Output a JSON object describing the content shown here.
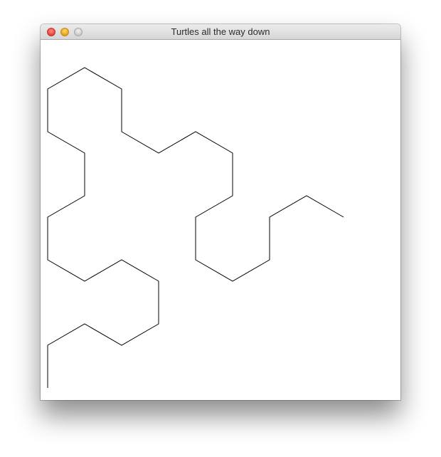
{
  "window": {
    "title": "Turtles all the way down",
    "controls": {
      "close_icon": "close-icon",
      "minimize_icon": "minimize-icon",
      "zoom_icon": "zoom-icon"
    }
  },
  "drawing": {
    "stroke_color": "#000000",
    "background": "#ffffff"
  }
}
